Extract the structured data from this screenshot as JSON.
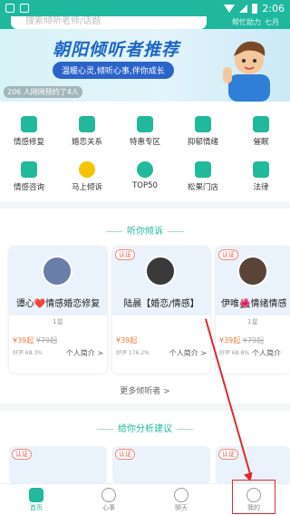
{
  "status_bar": {
    "time": "2:06"
  },
  "search": {
    "placeholder": "搜索倾听老师/话题"
  },
  "top_links": [
    "帮忙助力",
    "七月"
  ],
  "banner": {
    "title": "朝阳倾听者推荐",
    "subtitle": "温暖心灵,倾听心事,伴你成长",
    "caption": "206 人刚刚预约了4人"
  },
  "categories": [
    {
      "label": "情感修复",
      "icon": "heart-repair-icon"
    },
    {
      "label": "婚恋关系",
      "icon": "couple-icon"
    },
    {
      "label": "特惠专区",
      "icon": "discount-tag-icon"
    },
    {
      "label": "抑郁情绪",
      "icon": "mood-icon"
    },
    {
      "label": "催眠",
      "icon": "hypnosis-icon"
    },
    {
      "label": "情感咨询",
      "icon": "consult-icon"
    },
    {
      "label": "马上倾诉",
      "icon": "chat-bubble-icon"
    },
    {
      "label": "TOP50",
      "icon": "top50-icon"
    },
    {
      "label": "松果门店",
      "icon": "store-icon"
    },
    {
      "label": "法律",
      "icon": "law-icon"
    }
  ],
  "listen_section": {
    "title": "听你倾诉",
    "more": "更多倾听者 >"
  },
  "listeners": [
    {
      "badge": "",
      "name": "谭心❤️情感婚恋修复",
      "tags": "1星",
      "price": "¥39起",
      "old_price": "¥79起",
      "stats": "好评 68.3%",
      "intro": "个人简介 >"
    },
    {
      "badge": "认证",
      "name": "陆晨【婚恋/情感】",
      "tags": "",
      "price": "¥39起",
      "old_price": "",
      "stats": "好评 176.2%",
      "intro": "个人简介 >"
    },
    {
      "badge": "认证",
      "name": "伊唯🌺情绪情感",
      "tags": "1星",
      "price": "¥39起",
      "old_price": "¥79起",
      "stats": "好评 68.8%",
      "intro": "个人简介"
    }
  ],
  "analysis_section": {
    "title": "给你分析建议"
  },
  "analysts": [
    {
      "badge": "认证"
    },
    {
      "badge": "认证"
    },
    {
      "badge": "认证"
    }
  ],
  "tabs": [
    {
      "label": "首页",
      "icon": "home-icon",
      "active": true
    },
    {
      "label": "心事",
      "icon": "smile-icon",
      "active": false
    },
    {
      "label": "聊天",
      "icon": "chat-icon",
      "active": false
    },
    {
      "label": "我的",
      "icon": "profile-icon",
      "active": false
    }
  ],
  "colors": {
    "accent": "#22b89c",
    "banner_blue": "#1f66c6",
    "price": "#f07a36",
    "annotation": "#e0282e"
  }
}
